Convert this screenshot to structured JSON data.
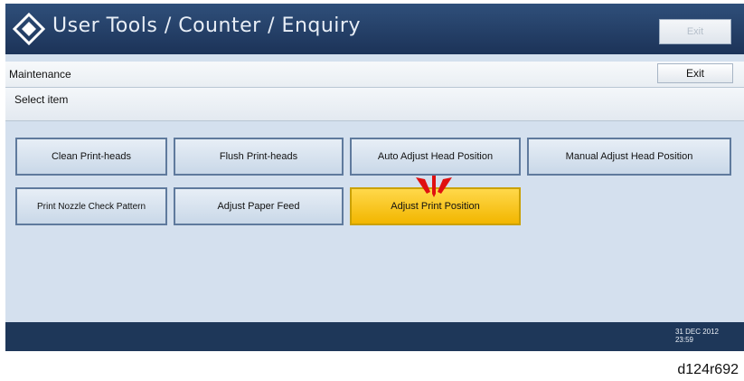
{
  "title_bar": {
    "title": "User Tools / Counter / Enquiry",
    "exit_label": "Exit"
  },
  "maintenance_bar": {
    "label": "Maintenance",
    "exit_label": "Exit"
  },
  "select_bar": {
    "label": "Select item"
  },
  "items": [
    {
      "label": "Clean Print-heads",
      "selected": false
    },
    {
      "label": "Flush Print-heads",
      "selected": false
    },
    {
      "label": "Auto Adjust Head Position",
      "selected": false
    },
    {
      "label": "Manual Adjust Head Position",
      "selected": false
    },
    {
      "label": "Print Nozzle Check Pattern",
      "selected": false
    },
    {
      "label": "Adjust Paper Feed",
      "selected": false
    },
    {
      "label": "Adjust Print Position",
      "selected": true
    }
  ],
  "status_bar": {
    "date": "31 DEC 2012",
    "time": "23:59"
  },
  "caption": "d124r692",
  "colors": {
    "title_bar": "#1c3358",
    "selected_item": "#f2b600",
    "arrow": "#e01010"
  }
}
